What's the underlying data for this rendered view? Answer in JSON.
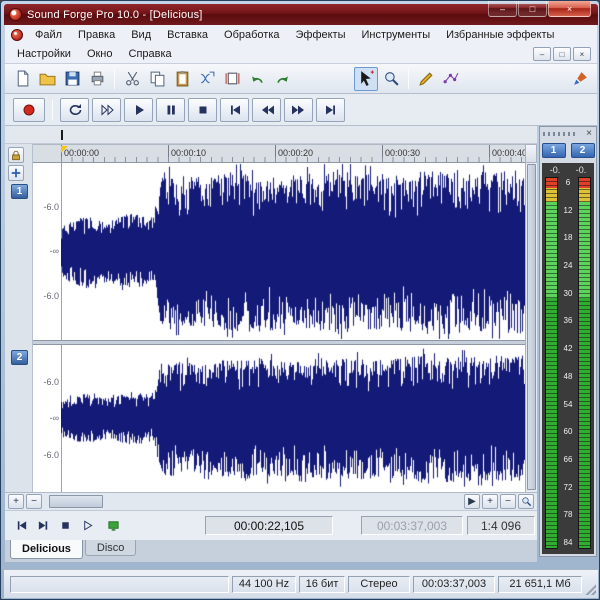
{
  "window": {
    "title": "Sound Forge Pro 10.0 - [Delicious]",
    "controls": {
      "minimize": "–",
      "maximize": "□",
      "close": "×"
    }
  },
  "menu": {
    "row1": [
      "Файл",
      "Правка",
      "Вид",
      "Вставка",
      "Обработка",
      "Эффекты",
      "Инструменты",
      "Избранные эффекты"
    ],
    "row2": [
      "Настройки",
      "Окно",
      "Справка"
    ],
    "child_controls": {
      "minimize": "–",
      "restore": "□",
      "close": "×"
    }
  },
  "toolbar": {
    "icons": [
      "new-file",
      "open-file",
      "save",
      "print",
      "cut",
      "copy",
      "paste",
      "mix",
      "trim",
      "undo",
      "redo",
      "edit-tool",
      "magnify",
      "pencil-tool",
      "envelope-tool",
      "effects-brush"
    ],
    "active_icon": "edit-tool"
  },
  "transport": {
    "icons": [
      "record",
      "loop-playback",
      "play-all",
      "play",
      "pause",
      "stop",
      "go-to-start",
      "rewind",
      "fast-forward",
      "go-to-end"
    ]
  },
  "ruler": {
    "labels": [
      "00:00:00",
      "00:00:10",
      "00:00:20",
      "00:00:30",
      "00:00:40"
    ]
  },
  "channels": [
    {
      "label": "1",
      "db_labels": [
        "-6.0",
        "-∞",
        "-6.0"
      ]
    },
    {
      "label": "2",
      "db_labels": [
        "-6.0",
        "-∞",
        "-6.0"
      ]
    }
  ],
  "waveform": {
    "color": "#141a78",
    "channels": [
      {
        "seed": 7,
        "envelope": [
          [
            0,
            0.3
          ],
          [
            0.05,
            0.42
          ],
          [
            0.1,
            0.34
          ],
          [
            0.15,
            0.44
          ],
          [
            0.2,
            0.38
          ],
          [
            0.215,
            0.9
          ],
          [
            0.3,
            0.84
          ],
          [
            0.4,
            0.93
          ],
          [
            0.5,
            0.86
          ],
          [
            0.6,
            0.94
          ],
          [
            0.7,
            0.87
          ],
          [
            0.8,
            0.95
          ],
          [
            0.9,
            0.9
          ],
          [
            1,
            0.93
          ]
        ]
      },
      {
        "seed": 13,
        "envelope": [
          [
            0,
            0.26
          ],
          [
            0.05,
            0.34
          ],
          [
            0.1,
            0.28
          ],
          [
            0.15,
            0.36
          ],
          [
            0.2,
            0.32
          ],
          [
            0.215,
            0.8
          ],
          [
            0.3,
            0.75
          ],
          [
            0.4,
            0.85
          ],
          [
            0.5,
            0.78
          ],
          [
            0.6,
            0.86
          ],
          [
            0.7,
            0.8
          ],
          [
            0.8,
            0.9
          ],
          [
            0.9,
            0.84
          ],
          [
            1,
            0.88
          ]
        ]
      }
    ]
  },
  "zoombar": {
    "plus": "+",
    "minus": "−",
    "arrow_right": "▶"
  },
  "playbar": {
    "position": "00:00:22,105",
    "total": "00:03:37,003",
    "zoom_ratio": "1:4 096"
  },
  "tabs": [
    {
      "label": "Delicious",
      "active": true
    },
    {
      "label": "Disco",
      "active": false
    }
  ],
  "meters": {
    "close": "×",
    "channel_buttons": [
      "1",
      "2"
    ],
    "peaks": [
      "-0.",
      "-0."
    ],
    "scale": [
      6,
      12,
      18,
      24,
      30,
      36,
      42,
      48,
      54,
      60,
      66,
      72,
      78,
      84
    ]
  },
  "status": {
    "sample_rate": "44 100 Hz",
    "bit_depth": "16 бит",
    "channel_mode": "Стерео",
    "length": "00:03:37,003",
    "free_space": "21 651,1 Мб"
  }
}
